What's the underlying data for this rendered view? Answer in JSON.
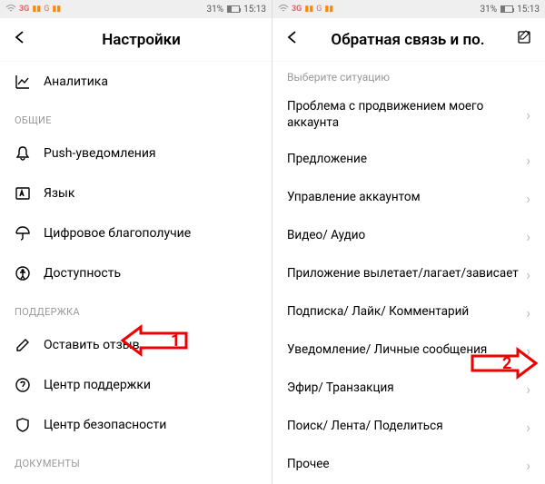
{
  "status": {
    "net1": "3G",
    "net2": "G",
    "battery_pct": "31%",
    "time": "15:13"
  },
  "left": {
    "title": "Настройки",
    "row_analytics": "Аналитика",
    "section_general": "ОБЩИЕ",
    "row_push": "Push-уведомления",
    "row_lang": "Язык",
    "row_digital": "Цифровое благополучие",
    "row_access": "Доступность",
    "section_support": "ПОДДЕРЖКА",
    "row_feedback": "Оставить отзыв",
    "row_helpcenter": "Центр поддержки",
    "row_safety": "Центр безопасности",
    "section_docs": "ДОКУМЕНТЫ"
  },
  "right": {
    "title": "Обратная связь и по.",
    "choose": "Выберите ситуацию",
    "opt_promo": "Проблема с продвижением моего аккаунта",
    "opt_suggest": "Предложение",
    "opt_account": "Управление аккаунтом",
    "opt_video": "Видео/ Аудио",
    "opt_crash": "Приложение вылетает/лагает/зависает",
    "opt_sub": "Подписка/ Лайк/ Комментарий",
    "opt_notif": "Уведомление/ Личные сообщения",
    "opt_live": "Эфир/ Транзакция",
    "opt_search": "Поиск/ Лента/ Поделиться",
    "opt_other": "Прочее"
  },
  "annotations": {
    "num1": "1",
    "num2": "2"
  }
}
